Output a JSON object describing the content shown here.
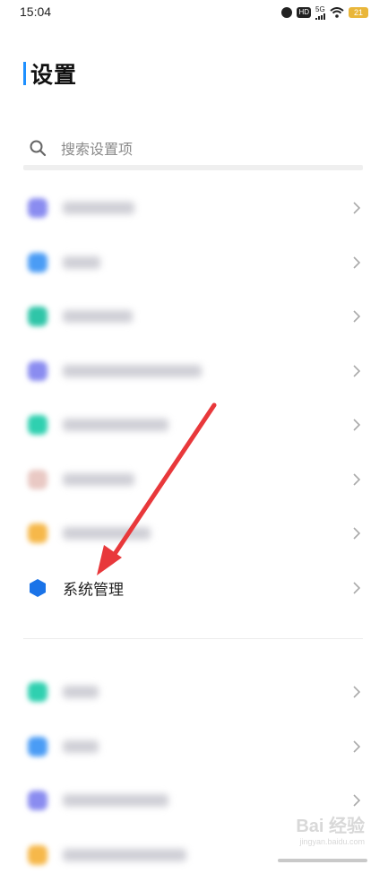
{
  "status_bar": {
    "time": "15:04",
    "network": "5G",
    "hd_badge": "HD",
    "battery": "21"
  },
  "header": {
    "title": "设置",
    "accent_color": "#1e90ff"
  },
  "search": {
    "placeholder": "搜索设置项",
    "icon": "search-icon"
  },
  "group1": [
    {
      "icon_color": "#8a8cf0",
      "blurred": true
    },
    {
      "icon_color": "#4a9cf5",
      "blurred": true
    },
    {
      "icon_color": "#2fc5a8",
      "blurred": true
    },
    {
      "icon_color": "#8a8cf0",
      "blurred": true
    },
    {
      "icon_color": "#2fd0b0",
      "blurred": true
    },
    {
      "icon_color": "#e9c9c4",
      "blurred": true
    },
    {
      "icon_color": "#f6b84a",
      "blurred": true
    },
    {
      "label": "系统管理",
      "icon": "hexagon-icon",
      "icon_color": "#1a73e8",
      "blurred": false
    }
  ],
  "group2": [
    {
      "icon_color": "#2fd0b0",
      "blurred": true
    },
    {
      "icon_color": "#4a9cf5",
      "blurred": true
    },
    {
      "icon_color": "#8a8cf0",
      "blurred": true
    },
    {
      "icon_color": "#f6b84a",
      "blurred": true
    }
  ],
  "annotation": {
    "arrow_color": "#e8383b"
  },
  "watermark": {
    "text": "Bai 经验",
    "sub": "jingyan.baidu.com"
  }
}
